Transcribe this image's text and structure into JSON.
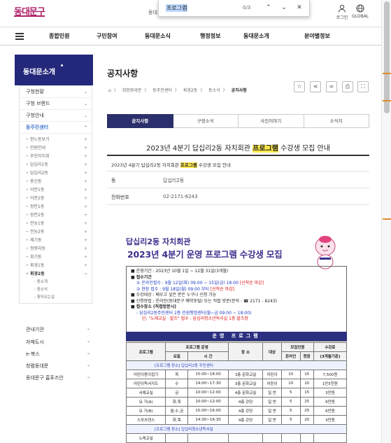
{
  "header": {
    "logo": "동대문구",
    "truncated_text": "동대",
    "icons": [
      {
        "label": "로그인",
        "icon": "user-icon"
      },
      {
        "label": "GLOBAL",
        "icon": "globe-icon"
      }
    ]
  },
  "findbar": {
    "query": "프로그램",
    "count": "0/3",
    "buttons": [
      "chevron-up-icon",
      "chevron-down-icon",
      "close-icon"
    ]
  },
  "nav": {
    "items": [
      "종합민원",
      "구민참여",
      "동대문소식",
      "행정정보",
      "동대문소개",
      "분야별정보"
    ]
  },
  "sidebar": {
    "head": "동대문소개",
    "items": [
      {
        "label": "구청현황"
      },
      {
        "label": "구청 브랜드"
      },
      {
        "label": "구청안내"
      },
      {
        "label": "동주민센터"
      }
    ],
    "subitems": [
      "현노동보기",
      "민원안내",
      "주민자치회",
      "답십리1동",
      "답십리2동",
      "용신동",
      "이문1동",
      "이문2동",
      "장안1동",
      "장안2동",
      "전농1동",
      "전농2동",
      "제기동",
      "청량리동",
      "회기동",
      "휘경1동",
      "휘경2동"
    ],
    "subsub": [
      "동소개",
      "동소식",
      "찾아오는길"
    ],
    "lower": [
      "관내기관",
      "자매도시",
      "e-북스",
      "청렴동대문",
      "동대문구 홈푸즈안"
    ]
  },
  "page": {
    "title": "공지사항",
    "breadcrumb": [
      "⌂",
      "〉",
      "희망동대문",
      "〉",
      "동주민센터",
      "〉",
      "휘경2동",
      "〉",
      "동소식",
      "〉",
      "공지사항"
    ],
    "tabs": [
      "공지사항",
      "구정소식",
      "사진이야기",
      "소식지"
    ],
    "post_title_pre": "2023년 4분기 답십리2동 자치회관 ",
    "post_title_hl": "프로그램",
    "post_title_post": " 수강생 모집 안내",
    "row_subject_pre": "2023년 4분기 답십리2동 자치회관 ",
    "row_subject_hl": "프로그램",
    "row_subject_post": " 수강생 모집 안내",
    "dept_label": "동",
    "dept_value": "답십리2동",
    "tel_label": "전화번호",
    "tel_value": "02-2171-6243"
  },
  "poster": {
    "subtitle": "답십리2동 자치회관",
    "title": "2023년 4분기 운영 프로그램 수강생 모집",
    "lines": {
      "l1": "■ 운영기간 : 2023년 10월 1일 ~ 12월 31일(3개월)",
      "l2": "■ 접수기간",
      "l3a": "① 온라인접수 : 9월 12일(화) 09:00 ~ 15일(금) 18:00",
      "l3b": "[선착순 마감]",
      "l4a": "② 현장 접수 : 9월 18일(월) 09:00 부터",
      "l4b": "[선착순 마감]",
      "l5": "■ 수강대상 : 배우고 싶은 분은 누구나 신청 가능",
      "l6": "■ 신청방법 : 온라인(동대문구 예약포털) 또는 직접 방문(문의 : ☎ 2171 - 6243)",
      "l7": "■ 접수장소 (직접방문시)",
      "l8": "- 답십리2동주민센터 2층 민원행정센터(월~금 09:00 ~ 18:00)",
      "l9": "단, \"노래교실 · 왈츠\" 접수 : 답십리청소년독서실 1층 왈츠장"
    },
    "banner": "운영 프로그램",
    "table": {
      "headers": [
        "프로그램",
        "프로그램 운영",
        "장 소",
        "대상",
        "모집인원",
        "수강료"
      ],
      "subheaders": [
        "요일",
        "시 간",
        "온라인",
        "현장",
        "(3개월기준)"
      ],
      "cat1": "[프로그램 장소] 답십리2동 주민센터",
      "rows": [
        [
          "어린이종이접기",
          "목",
          "15:00~18:00",
          "3층 문화교실",
          "어린이",
          "10",
          "15",
          "7,500원"
        ],
        [
          "어린이독서지도",
          "수",
          "14:00~17:30",
          "3층 문화교실",
          "어린이",
          "10",
          "10",
          "1만5천원"
        ],
        [
          "서예교실",
          "금",
          "10:00~12:00",
          "4층 문화교실",
          "일 반",
          "5",
          "15",
          "3만원"
        ],
        [
          "요 가(A)",
          "화,목",
          "10:00~12:00",
          "4층 강당",
          "일 반",
          "5",
          "25",
          "6만원"
        ],
        [
          "요 가(B)",
          "월,수,금",
          "15:00~16:00",
          "4층 강당",
          "일 반",
          "5",
          "25",
          "6만원"
        ],
        [
          "스포츠댄스",
          "화,목",
          "14:30~16:30",
          "4층 강당",
          "일 반",
          "5",
          "20",
          "3만원"
        ]
      ],
      "cat2": "[프로그램 장소] 답십리청소년독서실",
      "last_row_label": "노래교실"
    }
  }
}
